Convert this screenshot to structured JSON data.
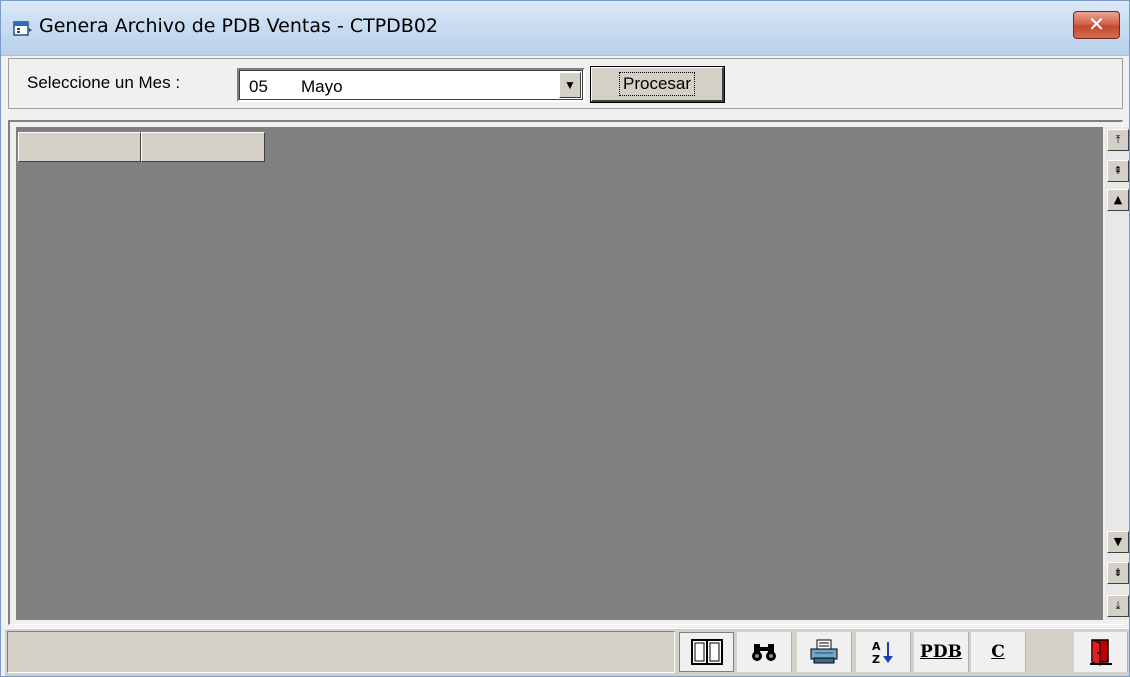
{
  "window": {
    "title": "Genera Archivo de PDB Ventas - CTPDB02",
    "close_label": "✕"
  },
  "form": {
    "mes_label": "Seleccione un Mes :",
    "mes_selected_code": "05",
    "mes_selected_name": "Mayo",
    "dropdown_arrow": "▼",
    "process_label": "Procesar"
  },
  "grid": {
    "columns": [
      "",
      ""
    ],
    "rows": []
  },
  "scrollbar": {
    "first": "⤒",
    "page_up": "⇞",
    "up": "▲",
    "down": "▼",
    "page_down": "⇟",
    "last": "⤓"
  },
  "statusbar": {
    "message": "",
    "tools": [
      {
        "icon": "book-icon"
      },
      {
        "icon": "binoculars-icon"
      },
      {
        "icon": "printer-icon"
      },
      {
        "icon": "sort-az-icon"
      },
      {
        "label": "PDB"
      },
      {
        "label": "C"
      },
      {
        "icon": "exit-door-icon"
      }
    ]
  }
}
